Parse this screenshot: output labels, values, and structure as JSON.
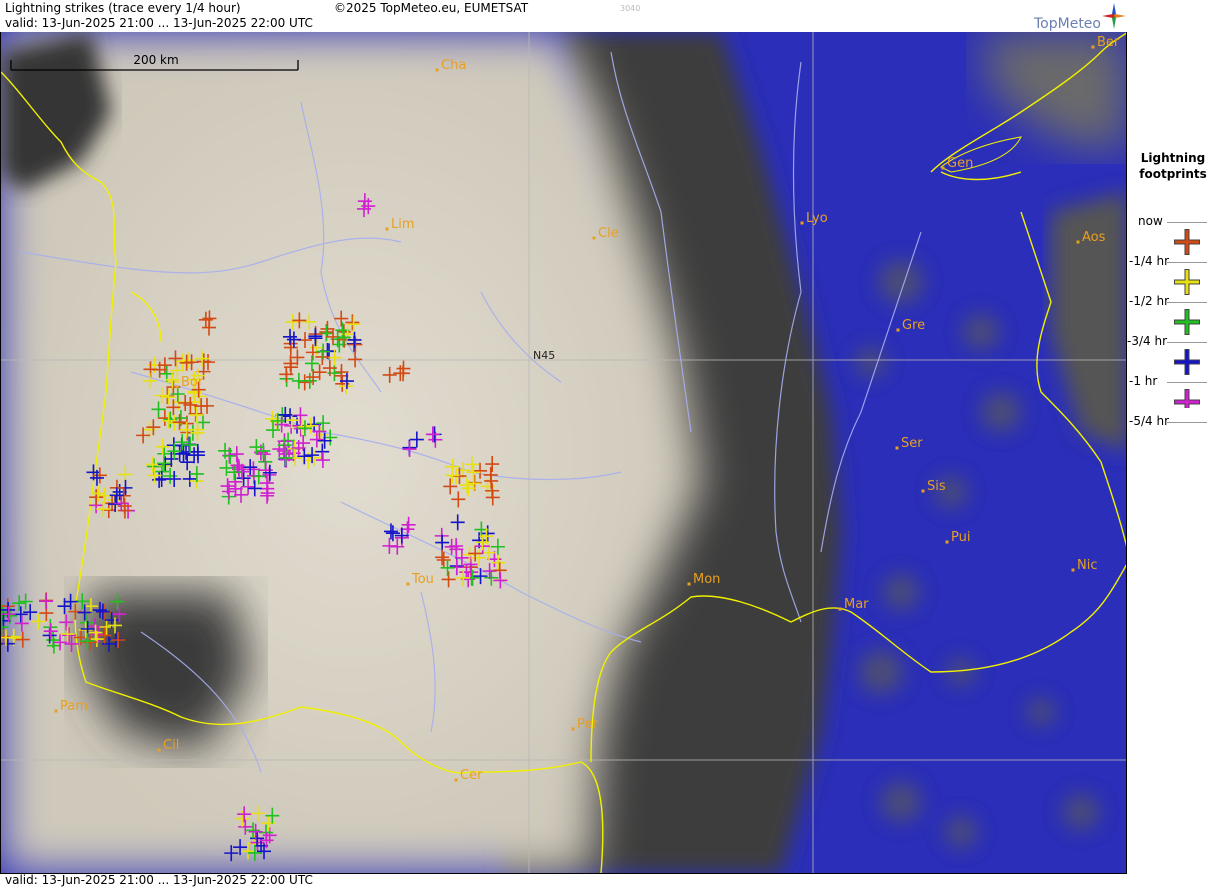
{
  "header": {
    "title": "Lightning strikes (trace every 1/4 hour)",
    "valid": "valid:  13-Jun-2025 21:00 ... 13-Jun-2025 22:00 UTC",
    "copyright": "©2025 TopMeteo.eu, EUMETSAT",
    "code": "3040",
    "logo": "TopMeteo"
  },
  "map": {
    "scale_label": "200 km",
    "lat_label": "N45",
    "cities": [
      {
        "name": "Cha"
      },
      {
        "name": "Lim"
      },
      {
        "name": "Cle"
      },
      {
        "name": "Lyo"
      },
      {
        "name": "Gen"
      },
      {
        "name": "Ber"
      },
      {
        "name": "Aos"
      },
      {
        "name": "Gre"
      },
      {
        "name": "Bor"
      },
      {
        "name": "Ser"
      },
      {
        "name": "Sis"
      },
      {
        "name": "Pui"
      },
      {
        "name": "Nic"
      },
      {
        "name": "Mon"
      },
      {
        "name": "Mar"
      },
      {
        "name": "Tou"
      },
      {
        "name": "Pam"
      },
      {
        "name": "Cil"
      },
      {
        "name": "Per"
      },
      {
        "name": "Cer"
      }
    ]
  },
  "legend": {
    "title_line1": "Lightning",
    "title_line2": "footprints",
    "items": [
      {
        "label": "now",
        "color": "#d34a14"
      },
      {
        "label": "-1/4 hr",
        "color": "#e8e010"
      },
      {
        "label": "-1/2 hr",
        "color": "#20c020"
      },
      {
        "label": "-3/4 hr",
        "color": "#1414c8"
      },
      {
        "label": "-1 hr",
        "color": "#d020d0"
      },
      {
        "label": "-5/4 hr",
        "color": ""
      }
    ]
  },
  "footer": {
    "valid": "valid:  13-Jun-2025 21:00 ... 13-Jun-2025 22:00 UTC"
  },
  "colors": {
    "sea": "#2a2eb8",
    "cloud": "#dcd6c8",
    "border": "#f0f000",
    "river": "#a6aef0",
    "city": "#e8a020"
  }
}
